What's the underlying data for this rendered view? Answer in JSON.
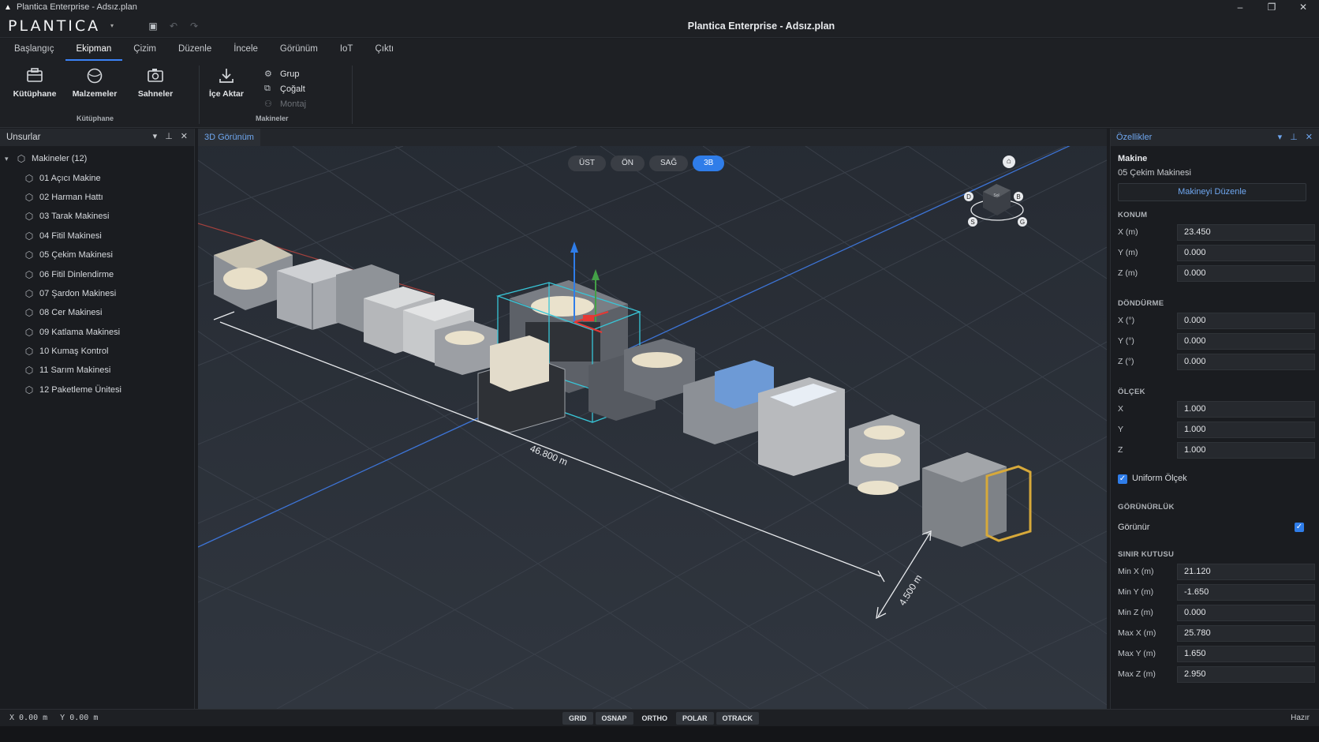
{
  "window": {
    "title": "Plantica Enterprise - Adsız.plan",
    "minimize": "–",
    "maximize": "❐",
    "close": "✕"
  },
  "header": {
    "logo": "PLANTICA",
    "doc_title": "Plantica Enterprise - Adsız.plan"
  },
  "tabs": [
    "Başlangıç",
    "Ekipman",
    "Çizim",
    "Düzenle",
    "İncele",
    "Görünüm",
    "IoT",
    "Çıktı"
  ],
  "active_tab": "Ekipman",
  "ribbon": {
    "library": {
      "label": "Kütüphane",
      "buttons": [
        "Kütüphane",
        "Malzemeler",
        "Sahneler"
      ]
    },
    "machines": {
      "label": "Makineler",
      "import": "İçe Aktar",
      "group": "Grup",
      "duplicate": "Çoğalt",
      "assembly": "Montaj"
    }
  },
  "left_panel": {
    "title": "Unsurlar",
    "root": "Makineler (12)",
    "items": [
      "01 Açıcı Makine",
      "02 Harman Hattı",
      "03 Tarak Makinesi",
      "04 Fitil Makinesi",
      "05 Çekim Makinesi",
      "06 Fitil Dinlendirme",
      "07 Şardon Makinesi",
      "08 Cer Makinesi",
      "09 Katlama Makinesi",
      "10 Kumaş Kontrol",
      "11 Sarım Makinesi",
      "12 Paketleme Ünitesi"
    ]
  },
  "viewport": {
    "tab": "3D Görünüm",
    "view_buttons": [
      "ÜST",
      "ÖN",
      "SAĞ",
      "3B"
    ],
    "active_view": "3B",
    "dim_length": "46.800 m",
    "dim_width": "4.500 m",
    "cube_labels": [
      "D",
      "B",
      "S",
      "G",
      "Sol"
    ]
  },
  "properties": {
    "title": "Özellikler",
    "type": "Makine",
    "name": "05 Çekim Makinesi",
    "edit_button": "Makineyi Düzenle",
    "position": {
      "header": "KONUM",
      "rows": [
        {
          "label": "X (m)",
          "value": "23.450"
        },
        {
          "label": "Y (m)",
          "value": "0.000"
        },
        {
          "label": "Z (m)",
          "value": "0.000"
        }
      ]
    },
    "rotation": {
      "header": "DÖNDÜRME",
      "rows": [
        {
          "label": "X (°)",
          "value": "0.000"
        },
        {
          "label": "Y (°)",
          "value": "0.000"
        },
        {
          "label": "Z (°)",
          "value": "0.000"
        }
      ]
    },
    "scale": {
      "header": "ÖLÇEK",
      "rows": [
        {
          "label": "X",
          "value": "1.000"
        },
        {
          "label": "Y",
          "value": "1.000"
        },
        {
          "label": "Z",
          "value": "1.000"
        }
      ],
      "uniform": "Uniform Ölçek"
    },
    "visibility": {
      "header": "GÖRÜNÜRLÜK",
      "label": "Görünür"
    },
    "bbox": {
      "header": "SINIR KUTUSU",
      "rows": [
        {
          "label": "Min X (m)",
          "value": "21.120"
        },
        {
          "label": "Min Y (m)",
          "value": "-1.650"
        },
        {
          "label": "Min Z (m)",
          "value": "0.000"
        },
        {
          "label": "Max X (m)",
          "value": "25.780"
        },
        {
          "label": "Max Y (m)",
          "value": "1.650"
        },
        {
          "label": "Max Z (m)",
          "value": "2.950"
        }
      ]
    }
  },
  "status": {
    "x": "X 0.00 m",
    "y": "Y 0.00 m",
    "snaps": [
      "GRID",
      "OSNAP",
      "ORTHO",
      "POLAR",
      "OTRACK"
    ],
    "ready": "Hazır"
  },
  "colors": {
    "accent": "#2f7de9",
    "selection": "#38c6d8",
    "axis_x": "#e53935",
    "axis_y": "#43a047",
    "axis_z": "#1e88e5"
  }
}
